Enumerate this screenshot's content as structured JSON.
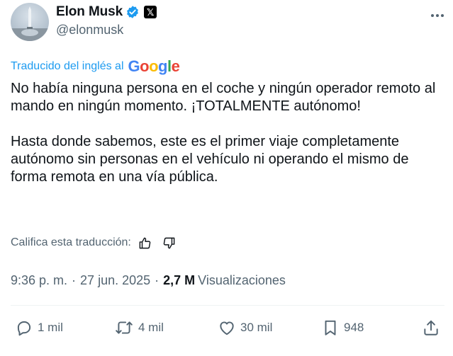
{
  "author": {
    "display_name": "Elon Musk",
    "handle": "@elonmusk",
    "verified_icon": "verified-badge-icon",
    "affiliation_badge": "𝕏"
  },
  "translation": {
    "label": "Traducido del inglés al",
    "provider_letters": [
      "G",
      "o",
      "o",
      "g",
      "l",
      "e"
    ]
  },
  "tweet": {
    "paragraphs": [
      "No había ninguna persona en el coche y ningún operador remoto al mando en ningún momento. ¡TOTALMENTE autónomo!",
      "Hasta donde sabemos, este es el primer viaje completamente autónomo sin personas en el vehículo ni operando el mismo de forma remota en una vía pública."
    ]
  },
  "rate": {
    "label": "Califica esta traducción:"
  },
  "meta": {
    "time": "9:36 p. m.",
    "date": "27 jun. 2025",
    "views_count": "2,7 M",
    "views_label": "Visualizaciones"
  },
  "actions": {
    "replies": "1 mil",
    "reposts": "4 mil",
    "likes": "30 mil",
    "bookmarks": "948"
  },
  "colors": {
    "accent": "#1d9bf0",
    "text": "#0f1419",
    "muted": "#536471"
  }
}
